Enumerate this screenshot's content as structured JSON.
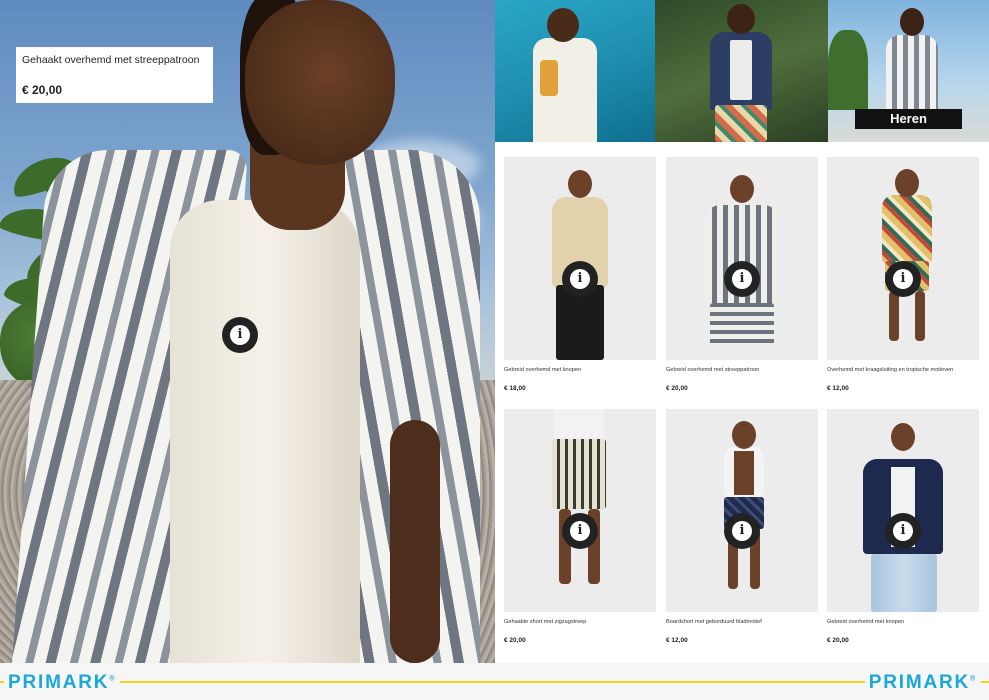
{
  "hero": {
    "product_name": "Gehaakt overhemd met streeppatroon",
    "price": "€ 20,00",
    "info_icon": "info-icon"
  },
  "top_strip": {
    "button_label": "Heren"
  },
  "products": [
    {
      "name": "Gebreid overhemd met knopen",
      "price": "€ 18,00",
      "info_icon": "info-icon"
    },
    {
      "name": "Gebreid overhemd met streeppatroon",
      "price": "€ 20,00",
      "info_icon": "info-icon"
    },
    {
      "name": "Overhemd met kraagsluiting en tropische motieven",
      "price": "€ 12,00",
      "info_icon": "info-icon"
    },
    {
      "name": "Gehaakte short met zigzagstreep",
      "price": "€ 20,00",
      "info_icon": "info-icon"
    },
    {
      "name": "Boardshort met geborduurd bladmotief",
      "price": "€ 12,00",
      "info_icon": "info-icon"
    },
    {
      "name": "Gebreid overhemd met knopen",
      "price": "€ 20,00",
      "info_icon": "info-icon"
    }
  ],
  "footer": {
    "logo_left": "PRIMARK",
    "logo_right": "PRIMARK",
    "trademark": "®"
  },
  "colors": {
    "brand_blue": "#1aa8d8",
    "footer_line_yellow": "#f2d21b",
    "button_black": "#111111"
  }
}
